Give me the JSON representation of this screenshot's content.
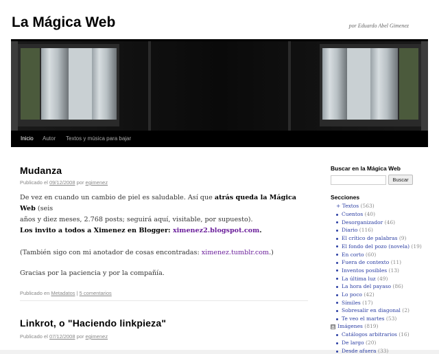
{
  "site": {
    "title": "La Mágica Web",
    "description": "por Eduardo Abel Gimenez"
  },
  "menu": [
    {
      "label": "Inicio",
      "current": true
    },
    {
      "label": "Autor",
      "current": false
    },
    {
      "label": "Textos y música para bajar",
      "current": false
    }
  ],
  "posts": [
    {
      "title": "Mudanza",
      "meta_prefix": "Publicado el",
      "date": "09/12/2008",
      "by": "por",
      "author": "egimenez",
      "p1_a": "De vez en cuando un cambio de piel es saludable. Así que ",
      "p1_b": "atrás queda la Mágica Web",
      "p1_c": " (seis",
      "p1_d": "años y diez meses, 2.768 posts; seguirá aquí, visitable, por supuesto).",
      "p2_a": "Los invito a todos a Ximenez en Blogger: ",
      "p2_link": "ximenez2.blogspot.com",
      "p2_c": ".",
      "p3_a": "(También sigo con mi anotador de cosas encontradas: ",
      "p3_link": "ximenez.tumblr.com",
      "p3_c": ".)",
      "p4": "Gracias por la paciencia y por la compañía.",
      "footer_prefix": "Publicado en",
      "category": "Metadatos",
      "separator": "|",
      "comments": "5 comentarios"
    },
    {
      "title": "Linkrot, o \"Haciendo linkpieza\"",
      "meta_prefix": "Publicado el",
      "date": "07/12/2008",
      "by": "por",
      "author": "egimenez"
    }
  ],
  "sidebar": {
    "search_title": "Buscar en la Mágica Web",
    "search_value": "",
    "search_button": "Buscar",
    "sections_title": "Secciones",
    "textos": {
      "label": "Textos",
      "count": "(563)",
      "toggle": "+"
    },
    "textos_children": [
      {
        "label": "Cuentos",
        "count": "(40)"
      },
      {
        "label": "Desorganizador",
        "count": "(46)"
      },
      {
        "label": "Diario",
        "count": "(116)"
      },
      {
        "label": "El crítico de palabras",
        "count": "(9)"
      },
      {
        "label": "El fondo del pozo (novela)",
        "count": "(19)"
      },
      {
        "label": "En corto",
        "count": "(60)"
      },
      {
        "label": "Fuera de contexto",
        "count": "(11)"
      },
      {
        "label": "Inventos posibles",
        "count": "(13)"
      },
      {
        "label": "La última luz",
        "count": "(49)"
      },
      {
        "label": "La hora del payaso",
        "count": "(86)"
      },
      {
        "label": "Lo poco",
        "count": "(42)"
      },
      {
        "label": "Símiles",
        "count": "(17)"
      },
      {
        "label": "Sobresalir en diagonal",
        "count": "(2)"
      },
      {
        "label": "Te veo el martes",
        "count": "(53)"
      }
    ],
    "imagenes": {
      "label": "Imágenes",
      "count": "(819)",
      "toggle": "⊟"
    },
    "imagenes_children": [
      {
        "label": "Catálogos arbitrarios",
        "count": "(16)"
      },
      {
        "label": "De largo",
        "count": "(20)"
      },
      {
        "label": "Desde afuera",
        "count": "(33)"
      }
    ]
  },
  "colors": {
    "link": "#2b3ea3",
    "visited": "#6b1f9b",
    "menu_bg": "#000000"
  }
}
